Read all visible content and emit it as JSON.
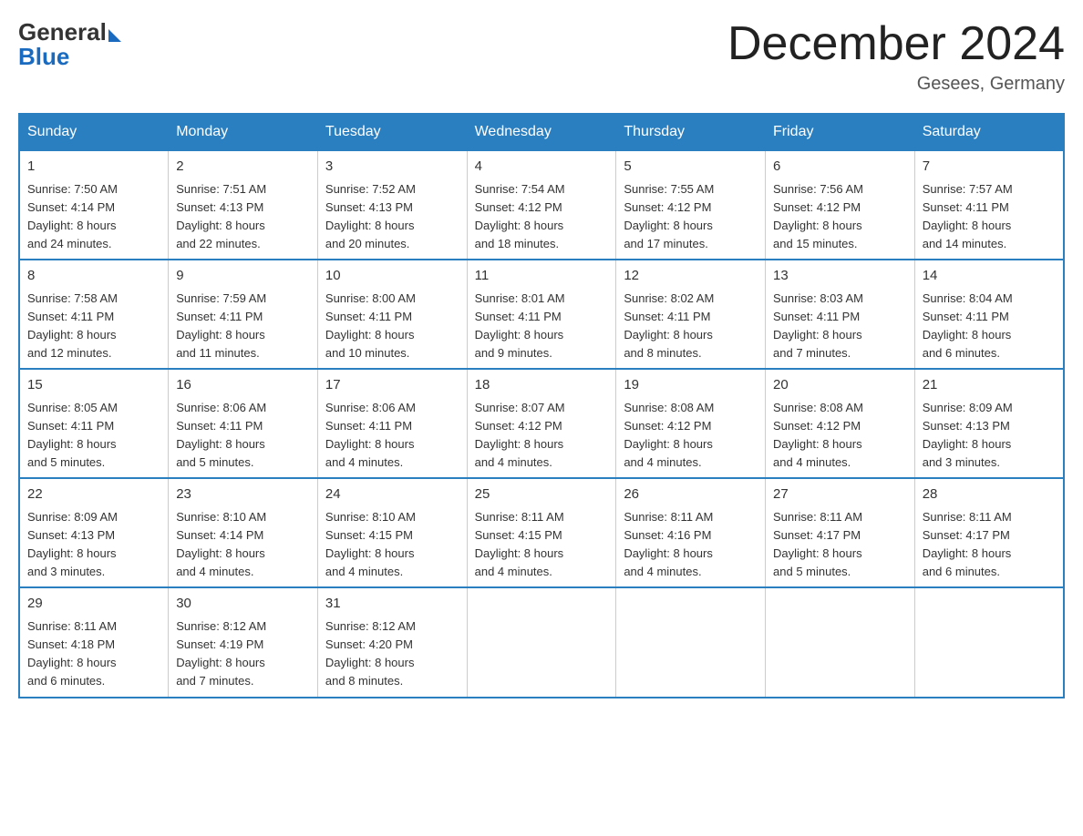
{
  "header": {
    "logo_general": "General",
    "logo_blue": "Blue",
    "month_title": "December 2024",
    "location": "Gesees, Germany"
  },
  "days_of_week": [
    "Sunday",
    "Monday",
    "Tuesday",
    "Wednesday",
    "Thursday",
    "Friday",
    "Saturday"
  ],
  "weeks": [
    [
      {
        "day": "1",
        "sunrise": "7:50 AM",
        "sunset": "4:14 PM",
        "daylight": "8 hours and 24 minutes."
      },
      {
        "day": "2",
        "sunrise": "7:51 AM",
        "sunset": "4:13 PM",
        "daylight": "8 hours and 22 minutes."
      },
      {
        "day": "3",
        "sunrise": "7:52 AM",
        "sunset": "4:13 PM",
        "daylight": "8 hours and 20 minutes."
      },
      {
        "day": "4",
        "sunrise": "7:54 AM",
        "sunset": "4:12 PM",
        "daylight": "8 hours and 18 minutes."
      },
      {
        "day": "5",
        "sunrise": "7:55 AM",
        "sunset": "4:12 PM",
        "daylight": "8 hours and 17 minutes."
      },
      {
        "day": "6",
        "sunrise": "7:56 AM",
        "sunset": "4:12 PM",
        "daylight": "8 hours and 15 minutes."
      },
      {
        "day": "7",
        "sunrise": "7:57 AM",
        "sunset": "4:11 PM",
        "daylight": "8 hours and 14 minutes."
      }
    ],
    [
      {
        "day": "8",
        "sunrise": "7:58 AM",
        "sunset": "4:11 PM",
        "daylight": "8 hours and 12 minutes."
      },
      {
        "day": "9",
        "sunrise": "7:59 AM",
        "sunset": "4:11 PM",
        "daylight": "8 hours and 11 minutes."
      },
      {
        "day": "10",
        "sunrise": "8:00 AM",
        "sunset": "4:11 PM",
        "daylight": "8 hours and 10 minutes."
      },
      {
        "day": "11",
        "sunrise": "8:01 AM",
        "sunset": "4:11 PM",
        "daylight": "8 hours and 9 minutes."
      },
      {
        "day": "12",
        "sunrise": "8:02 AM",
        "sunset": "4:11 PM",
        "daylight": "8 hours and 8 minutes."
      },
      {
        "day": "13",
        "sunrise": "8:03 AM",
        "sunset": "4:11 PM",
        "daylight": "8 hours and 7 minutes."
      },
      {
        "day": "14",
        "sunrise": "8:04 AM",
        "sunset": "4:11 PM",
        "daylight": "8 hours and 6 minutes."
      }
    ],
    [
      {
        "day": "15",
        "sunrise": "8:05 AM",
        "sunset": "4:11 PM",
        "daylight": "8 hours and 5 minutes."
      },
      {
        "day": "16",
        "sunrise": "8:06 AM",
        "sunset": "4:11 PM",
        "daylight": "8 hours and 5 minutes."
      },
      {
        "day": "17",
        "sunrise": "8:06 AM",
        "sunset": "4:11 PM",
        "daylight": "8 hours and 4 minutes."
      },
      {
        "day": "18",
        "sunrise": "8:07 AM",
        "sunset": "4:12 PM",
        "daylight": "8 hours and 4 minutes."
      },
      {
        "day": "19",
        "sunrise": "8:08 AM",
        "sunset": "4:12 PM",
        "daylight": "8 hours and 4 minutes."
      },
      {
        "day": "20",
        "sunrise": "8:08 AM",
        "sunset": "4:12 PM",
        "daylight": "8 hours and 4 minutes."
      },
      {
        "day": "21",
        "sunrise": "8:09 AM",
        "sunset": "4:13 PM",
        "daylight": "8 hours and 3 minutes."
      }
    ],
    [
      {
        "day": "22",
        "sunrise": "8:09 AM",
        "sunset": "4:13 PM",
        "daylight": "8 hours and 3 minutes."
      },
      {
        "day": "23",
        "sunrise": "8:10 AM",
        "sunset": "4:14 PM",
        "daylight": "8 hours and 4 minutes."
      },
      {
        "day": "24",
        "sunrise": "8:10 AM",
        "sunset": "4:15 PM",
        "daylight": "8 hours and 4 minutes."
      },
      {
        "day": "25",
        "sunrise": "8:11 AM",
        "sunset": "4:15 PM",
        "daylight": "8 hours and 4 minutes."
      },
      {
        "day": "26",
        "sunrise": "8:11 AM",
        "sunset": "4:16 PM",
        "daylight": "8 hours and 4 minutes."
      },
      {
        "day": "27",
        "sunrise": "8:11 AM",
        "sunset": "4:17 PM",
        "daylight": "8 hours and 5 minutes."
      },
      {
        "day": "28",
        "sunrise": "8:11 AM",
        "sunset": "4:17 PM",
        "daylight": "8 hours and 6 minutes."
      }
    ],
    [
      {
        "day": "29",
        "sunrise": "8:11 AM",
        "sunset": "4:18 PM",
        "daylight": "8 hours and 6 minutes."
      },
      {
        "day": "30",
        "sunrise": "8:12 AM",
        "sunset": "4:19 PM",
        "daylight": "8 hours and 7 minutes."
      },
      {
        "day": "31",
        "sunrise": "8:12 AM",
        "sunset": "4:20 PM",
        "daylight": "8 hours and 8 minutes."
      },
      null,
      null,
      null,
      null
    ]
  ],
  "labels": {
    "sunrise": "Sunrise:",
    "sunset": "Sunset:",
    "daylight": "Daylight:"
  }
}
